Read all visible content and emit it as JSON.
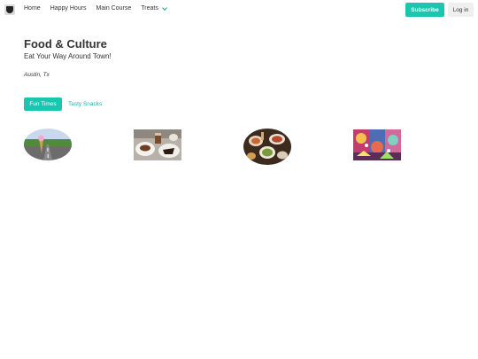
{
  "nav": {
    "logo_icon": "coffee-cup-icon",
    "links": [
      "Home",
      "Happy Hours",
      "Main Course",
      "Treats"
    ],
    "treats_icon": "chevron-down-icon"
  },
  "actions": {
    "subscribe_label": "Subscribe",
    "login_label": "Log in"
  },
  "hero": {
    "title": "Food & Culture",
    "subtitle": "Eat Your Way Around Town!",
    "location": "Austin, Tx"
  },
  "tabs": [
    {
      "label": "Fun Times",
      "active": true
    },
    {
      "label": "Tasty Snacks",
      "active": false
    }
  ],
  "colors": {
    "accent": "#1ac6b0",
    "tab_text": "#1ab2a8",
    "text": "#333333"
  }
}
